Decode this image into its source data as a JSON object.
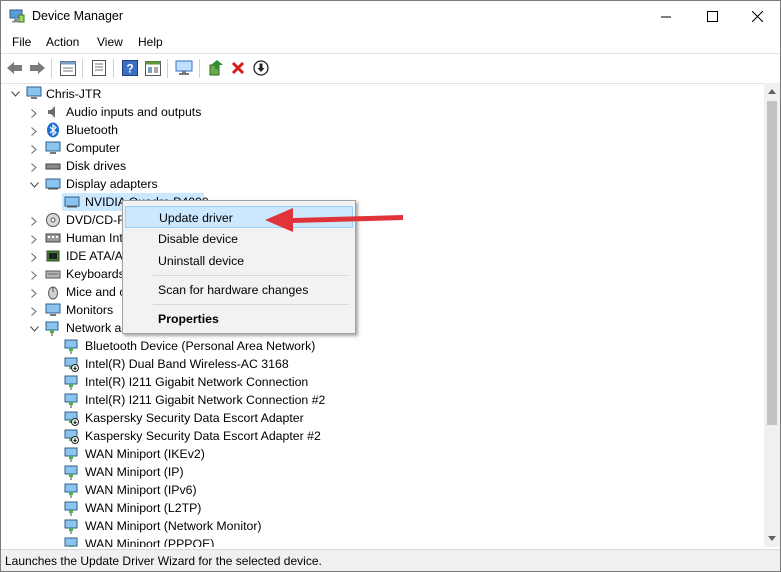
{
  "window": {
    "title": "Device Manager"
  },
  "menu": [
    "File",
    "Action",
    "View",
    "Help"
  ],
  "toolbar": {
    "icons": [
      "back-icon",
      "forward-icon",
      "properties-view-icon",
      "list-view-icon",
      "help-icon",
      "resource-view-icon",
      "monitor-icon",
      "update-driver-icon",
      "uninstall-icon",
      "download-icon"
    ]
  },
  "tree": {
    "root": "Chris-JTR",
    "categories": [
      "Audio inputs and outputs",
      "Bluetooth",
      "Computer",
      "Disk drives",
      "Display adapters",
      "NVIDIA Quadro P4000",
      "DVD/CD-R",
      "Human Int",
      "IDE ATA/AT",
      "Keyboards",
      "Mice and c",
      "Monitors",
      "Network ad"
    ],
    "network_devices": [
      "Bluetooth Device (Personal Area Network)",
      "Intel(R) Dual Band Wireless-AC 3168",
      "Intel(R) I211 Gigabit Network Connection",
      "Intel(R) I211 Gigabit Network Connection #2",
      "Kaspersky Security Data Escort Adapter",
      "Kaspersky Security Data Escort Adapter #2",
      "WAN Miniport (IKEv2)",
      "WAN Miniport (IP)",
      "WAN Miniport (IPv6)",
      "WAN Miniport (L2TP)",
      "WAN Miniport (Network Monitor)",
      "WAN Miniport (PPPOE)"
    ]
  },
  "context_menu": {
    "update": "Update driver",
    "disable": "Disable device",
    "uninstall": "Uninstall device",
    "scan": "Scan for hardware changes",
    "properties": "Properties"
  },
  "status": "Launches the Update Driver Wizard for the selected device.",
  "colors": {
    "selection": "#cce8ff",
    "arrow": "#e0333a",
    "accent": "#0078d7"
  }
}
